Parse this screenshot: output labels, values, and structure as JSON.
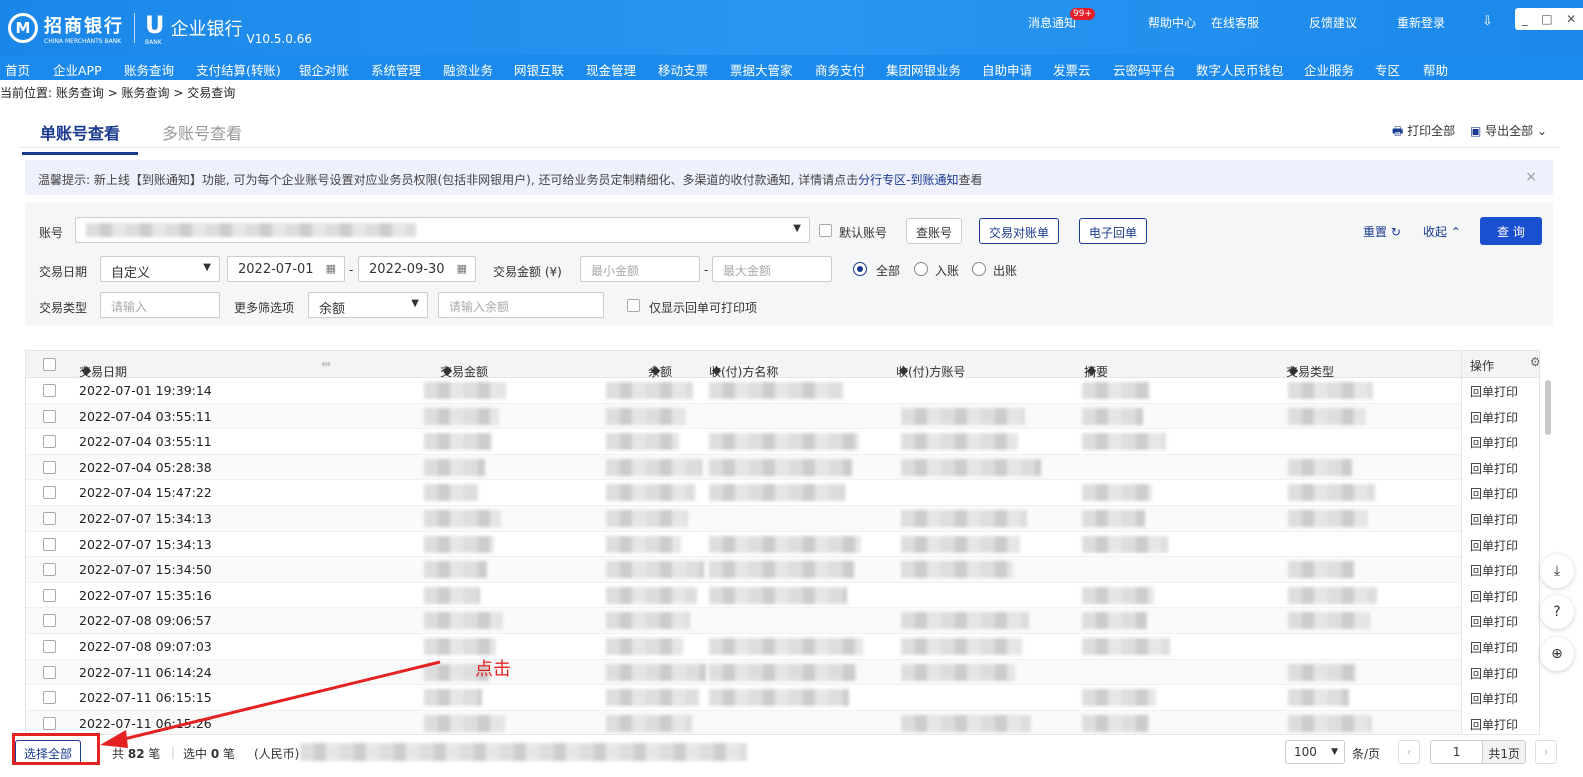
{
  "header": {
    "bank_name": "招商银行",
    "bank_en": "CHINA MERCHANTS BANK",
    "product": "企业银行",
    "ubank": "BANK",
    "version": "V10.5.0.66",
    "links": [
      "消息通知",
      "帮助中心",
      "在线客服",
      "反馈建议",
      "重新登录"
    ],
    "msg_badge": "99+"
  },
  "nav": [
    "首页",
    "企业APP",
    "账务查询",
    "支付结算(转账)",
    "银企对账",
    "系统管理",
    "融资业务",
    "网银互联",
    "现金管理",
    "移动支票",
    "票据大管家",
    "商务支付",
    "集团网银业务",
    "自助申请",
    "发票云",
    "云密码平台",
    "数字人民币钱包",
    "企业服务",
    "专区",
    "帮助"
  ],
  "breadcrumb": "当前位置: 账务查询 > 账务查询 > 交易查询",
  "tabs": {
    "active": "单账号查看",
    "inactive": "多账号查看",
    "print_all": "打印全部",
    "export_all": "导出全部"
  },
  "notice": {
    "text": "温馨提示: 新上线【到账通知】功能, 可为每个企业账号设置对应业务员权限(包括非网银用户), 还可给业务员定制精细化、多渠道的收付款通知, 详情请点击",
    "link": "分行专区-到账通知",
    "tail": "查看"
  },
  "filter": {
    "account_label": "账号",
    "default_account": "默认账号",
    "btn_lookup": "查账号",
    "btn_statement": "交易对账单",
    "btn_receipt": "电子回单",
    "reset": "重置",
    "collapse": "收起",
    "query": "查 询",
    "date_label": "交易日期",
    "date_mode": "自定义",
    "date_from": "2022-07-01",
    "date_to": "2022-09-30",
    "amount_label": "交易金额 (¥)",
    "min_ph": "最小金额",
    "max_ph": "最大金额",
    "direction": [
      "全部",
      "入账",
      "出账"
    ],
    "direction_selected": "全部",
    "type_label": "交易类型",
    "type_ph": "请输入",
    "more_label": "更多筛选项",
    "more_value": "余额",
    "balance_ph": "请输入余额",
    "only_printable": "仅显示回单可打印项"
  },
  "table": {
    "columns": [
      "交易日期",
      "交易金额",
      "余额",
      "收(付)方名称",
      "收(付)方账号",
      "摘要",
      "交易类型",
      "操作"
    ],
    "rows": [
      {
        "date": "2022-07-01 19:39:14",
        "op": "回单打印",
        "enabled": true
      },
      {
        "date": "2022-07-04 03:55:11",
        "op": "回单打印",
        "enabled": true
      },
      {
        "date": "2022-07-04 03:55:11",
        "op": "回单打印",
        "enabled": true
      },
      {
        "date": "2022-07-04 05:28:38",
        "op": "回单打印",
        "enabled": true
      },
      {
        "date": "2022-07-04 15:47:22",
        "op": "回单打印",
        "enabled": false
      },
      {
        "date": "2022-07-07 15:34:13",
        "op": "回单打印",
        "enabled": true
      },
      {
        "date": "2022-07-07 15:34:13",
        "op": "回单打印",
        "enabled": true
      },
      {
        "date": "2022-07-07 15:34:50",
        "op": "回单打印",
        "enabled": true
      },
      {
        "date": "2022-07-07 15:35:16",
        "op": "回单打印",
        "enabled": true
      },
      {
        "date": "2022-07-08 09:06:57",
        "op": "回单打印",
        "enabled": false
      },
      {
        "date": "2022-07-08 09:07:03",
        "op": "回单打印",
        "enabled": false
      },
      {
        "date": "2022-07-11 06:14:24",
        "op": "回单打印",
        "enabled": false
      },
      {
        "date": "2022-07-11 06:15:15",
        "op": "回单打印",
        "enabled": false
      },
      {
        "date": "2022-07-11 06:15:26",
        "op": "回单打印",
        "enabled": false
      }
    ]
  },
  "footer": {
    "select_all": "选择全部",
    "total_prefix": "共",
    "total": "82",
    "unit": "笔",
    "selected_prefix": "选中",
    "selected": "0",
    "currency": "(人民币)",
    "page_size": "100",
    "per_page": "条/页",
    "page": "1",
    "total_pages": "共1页"
  },
  "annotation": {
    "text": "点击",
    "color": "#e52222"
  },
  "colors": {
    "brand": "#1a86e8",
    "accent": "#1a3a8f"
  }
}
